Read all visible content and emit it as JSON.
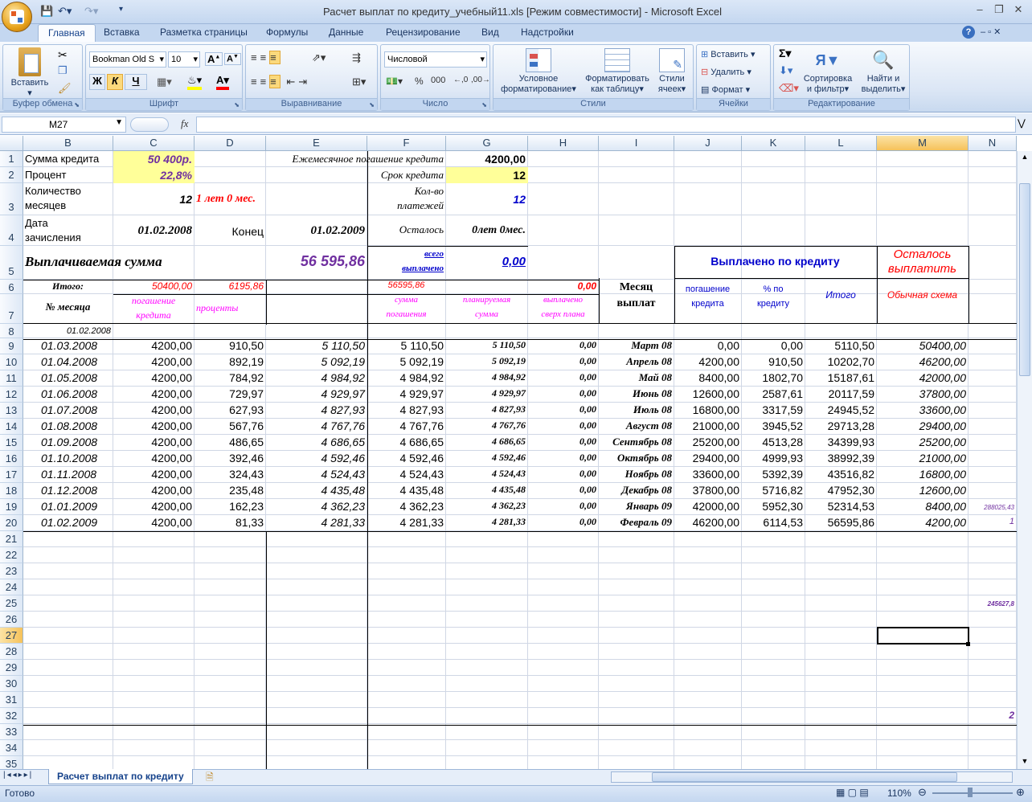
{
  "window": {
    "title": "Расчет выплат по кредиту_учебный11.xls  [Режим совместимости] - Microsoft Excel"
  },
  "tabs": [
    "Главная",
    "Вставка",
    "Разметка страницы",
    "Формулы",
    "Данные",
    "Рецензирование",
    "Вид",
    "Надстройки"
  ],
  "ribbon": {
    "clipboard": {
      "label": "Буфер обмена",
      "paste": "Вставить"
    },
    "font": {
      "label": "Шрифт",
      "name": "Bookman Old S",
      "size": "10",
      "bold": "Ж",
      "italic": "К",
      "underline": "Ч"
    },
    "alignment": {
      "label": "Выравнивание"
    },
    "number": {
      "label": "Число",
      "format": "Числовой"
    },
    "styles": {
      "label": "Стили",
      "cond1": "Условное",
      "cond2": "форматирование",
      "table1": "Форматировать",
      "table2": "как таблицу",
      "cell1": "Стили",
      "cell2": "ячеек"
    },
    "cells": {
      "label": "Ячейки",
      "insert": "Вставить",
      "delete": "Удалить",
      "format": "Формат"
    },
    "editing": {
      "label": "Редактирование",
      "sort1": "Сортировка",
      "sort2": "и фильтр",
      "find1": "Найти и",
      "find2": "выделить",
      "sigma": "Σ"
    }
  },
  "formula": {
    "namebox": "M27",
    "fx": "fx",
    "value": ""
  },
  "columns": [
    "B",
    "C",
    "D",
    "E",
    "F",
    "G",
    "H",
    "I",
    "J",
    "K",
    "L",
    "M",
    "N"
  ],
  "rows": [
    "1",
    "2",
    "3",
    "4",
    "5",
    "6",
    "7",
    "8",
    "9",
    "10",
    "11",
    "12",
    "13",
    "14",
    "15",
    "16",
    "17",
    "18",
    "19",
    "20",
    "21",
    "22",
    "23",
    "24",
    "25",
    "26",
    "27",
    "28",
    "29",
    "30",
    "31",
    "32",
    "33",
    "34",
    "35"
  ],
  "header": {
    "b1": "Сумма кредита",
    "c1": "50 400р.",
    "f1": "Ежемесячное погашение кредита",
    "g1": "4200,00",
    "b2": "Процент",
    "c2": "22,8%",
    "f2": "Срок кредита",
    "g2": "12",
    "b3a": "Количество",
    "b3b": "месяцев",
    "c3": "12",
    "d3": "1 лет 0 мес.",
    "f3a": "Кол-во",
    "f3b": "платежей",
    "g3": "12",
    "b4a": "Дата",
    "b4b": "зачисления",
    "c4": "01.02.2008",
    "d4": "Конец",
    "e4": "01.02.2009",
    "f4": "Осталось",
    "g4": "0лет 0мес.",
    "b5": "Выплачиваемая сумма",
    "e5": "56 595,86",
    "f5a": "всего",
    "f5b": "выплачено",
    "g5": "0,00",
    "j5": "Выплачено по кредиту",
    "m5a": "Осталось",
    "m5b": "выплатить",
    "b6": "Итого:",
    "c6": "50400,00",
    "d6": "6195,86",
    "f6": "56595,86",
    "h6": "0,00",
    "i6a": "Месяц",
    "i6b": "выплат",
    "b7": "№ месяца",
    "c7a": "погашение",
    "c7b": "кредита",
    "d7": "проценты",
    "f7a": "сумма",
    "f7b": "погашения",
    "g7a": "планируемая",
    "g7b": "сумма",
    "h7a": "выплачено",
    "h7b": "сверх плана",
    "j6a": "погашение",
    "j6b": "кредита",
    "k6a": "% по",
    "k6b": "кредиту",
    "l6": "Итого",
    "m6": "Обычная схема",
    "b8": "01.02.2008"
  },
  "table": [
    [
      "01.03.2008",
      "4200,00",
      "910,50",
      "5 110,50",
      "5 110,50",
      "5 110,50",
      "0,00",
      "Март 08",
      "0,00",
      "0,00",
      "5110,50",
      "50400,00"
    ],
    [
      "01.04.2008",
      "4200,00",
      "892,19",
      "5 092,19",
      "5 092,19",
      "5 092,19",
      "0,00",
      "Апрель 08",
      "4200,00",
      "910,50",
      "10202,70",
      "46200,00"
    ],
    [
      "01.05.2008",
      "4200,00",
      "784,92",
      "4 984,92",
      "4 984,92",
      "4 984,92",
      "0,00",
      "Май 08",
      "8400,00",
      "1802,70",
      "15187,61",
      "42000,00"
    ],
    [
      "01.06.2008",
      "4200,00",
      "729,97",
      "4 929,97",
      "4 929,97",
      "4 929,97",
      "0,00",
      "Июнь 08",
      "12600,00",
      "2587,61",
      "20117,59",
      "37800,00"
    ],
    [
      "01.07.2008",
      "4200,00",
      "627,93",
      "4 827,93",
      "4 827,93",
      "4 827,93",
      "0,00",
      "Июль 08",
      "16800,00",
      "3317,59",
      "24945,52",
      "33600,00"
    ],
    [
      "01.08.2008",
      "4200,00",
      "567,76",
      "4 767,76",
      "4 767,76",
      "4 767,76",
      "0,00",
      "Август 08",
      "21000,00",
      "3945,52",
      "29713,28",
      "29400,00"
    ],
    [
      "01.09.2008",
      "4200,00",
      "486,65",
      "4 686,65",
      "4 686,65",
      "4 686,65",
      "0,00",
      "Сентябрь 08",
      "25200,00",
      "4513,28",
      "34399,93",
      "25200,00"
    ],
    [
      "01.10.2008",
      "4200,00",
      "392,46",
      "4 592,46",
      "4 592,46",
      "4 592,46",
      "0,00",
      "Октябрь 08",
      "29400,00",
      "4999,93",
      "38992,39",
      "21000,00"
    ],
    [
      "01.11.2008",
      "4200,00",
      "324,43",
      "4 524,43",
      "4 524,43",
      "4 524,43",
      "0,00",
      "Ноябрь 08",
      "33600,00",
      "5392,39",
      "43516,82",
      "16800,00"
    ],
    [
      "01.12.2008",
      "4200,00",
      "235,48",
      "4 435,48",
      "4 435,48",
      "4 435,48",
      "0,00",
      "Декабрь 08",
      "37800,00",
      "5716,82",
      "47952,30",
      "12600,00"
    ],
    [
      "01.01.2009",
      "4200,00",
      "162,23",
      "4 362,23",
      "4 362,23",
      "4 362,23",
      "0,00",
      "Январь 09",
      "42000,00",
      "5952,30",
      "52314,53",
      "8400,00"
    ],
    [
      "01.02.2009",
      "4200,00",
      "81,33",
      "4 281,33",
      "4 281,33",
      "4 281,33",
      "0,00",
      "Февраль 09",
      "46200,00",
      "6114,53",
      "56595,86",
      "4200,00"
    ]
  ],
  "side": {
    "n19": "288025,43",
    "n20": "1",
    "n25": "245627,8",
    "n32": "2"
  },
  "sheet": {
    "tab": "Расчет выплат по кредиту"
  },
  "status": {
    "ready": "Готово",
    "zoom": "110%"
  }
}
